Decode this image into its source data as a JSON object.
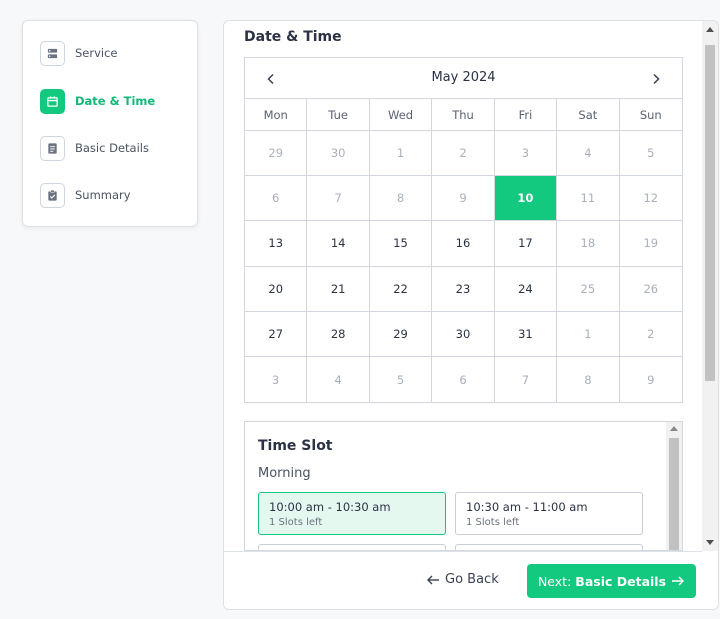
{
  "sidebar": {
    "steps": [
      {
        "label": "Service",
        "icon": "server-icon",
        "active": false
      },
      {
        "label": "Date & Time",
        "icon": "calendar-icon",
        "active": true
      },
      {
        "label": "Basic Details",
        "icon": "document-icon",
        "active": false
      },
      {
        "label": "Summary",
        "icon": "clipboard-check-icon",
        "active": false
      }
    ]
  },
  "main": {
    "title": "Date & Time",
    "calendar": {
      "month_label": "May 2024",
      "weekdays": [
        "Mon",
        "Tue",
        "Wed",
        "Thu",
        "Fri",
        "Sat",
        "Sun"
      ],
      "selected": "10",
      "weeks": [
        [
          {
            "d": "29",
            "muted": true
          },
          {
            "d": "30",
            "muted": true
          },
          {
            "d": "1",
            "muted": true
          },
          {
            "d": "2",
            "muted": true
          },
          {
            "d": "3",
            "muted": true
          },
          {
            "d": "4",
            "muted": true
          },
          {
            "d": "5",
            "muted": true
          }
        ],
        [
          {
            "d": "6",
            "muted": true
          },
          {
            "d": "7",
            "muted": true
          },
          {
            "d": "8",
            "muted": true
          },
          {
            "d": "9",
            "muted": true
          },
          {
            "d": "10",
            "muted": false
          },
          {
            "d": "11",
            "muted": true
          },
          {
            "d": "12",
            "muted": true
          }
        ],
        [
          {
            "d": "13",
            "muted": false
          },
          {
            "d": "14",
            "muted": false
          },
          {
            "d": "15",
            "muted": false
          },
          {
            "d": "16",
            "muted": false
          },
          {
            "d": "17",
            "muted": false
          },
          {
            "d": "18",
            "muted": true
          },
          {
            "d": "19",
            "muted": true
          }
        ],
        [
          {
            "d": "20",
            "muted": false
          },
          {
            "d": "21",
            "muted": false
          },
          {
            "d": "22",
            "muted": false
          },
          {
            "d": "23",
            "muted": false
          },
          {
            "d": "24",
            "muted": false
          },
          {
            "d": "25",
            "muted": true
          },
          {
            "d": "26",
            "muted": true
          }
        ],
        [
          {
            "d": "27",
            "muted": false
          },
          {
            "d": "28",
            "muted": false
          },
          {
            "d": "29",
            "muted": false
          },
          {
            "d": "30",
            "muted": false
          },
          {
            "d": "31",
            "muted": false
          },
          {
            "d": "1",
            "muted": true
          },
          {
            "d": "2",
            "muted": true
          }
        ],
        [
          {
            "d": "3",
            "muted": true
          },
          {
            "d": "4",
            "muted": true
          },
          {
            "d": "5",
            "muted": true
          },
          {
            "d": "6",
            "muted": true
          },
          {
            "d": "7",
            "muted": true
          },
          {
            "d": "8",
            "muted": true
          },
          {
            "d": "9",
            "muted": true
          }
        ]
      ]
    },
    "time_slot": {
      "title": "Time Slot",
      "period": "Morning",
      "slots": [
        {
          "time": "10:00 am - 10:30 am",
          "left": "1 Slots left",
          "selected": true
        },
        {
          "time": "10:30 am - 11:00 am",
          "left": "1 Slots left",
          "selected": false
        }
      ]
    }
  },
  "footer": {
    "back_label": "Go Back",
    "next_prefix": "Next:",
    "next_target": "Basic Details"
  },
  "colors": {
    "accent": "#12c97f",
    "selected_slot_bg": "#e4f8ef"
  }
}
